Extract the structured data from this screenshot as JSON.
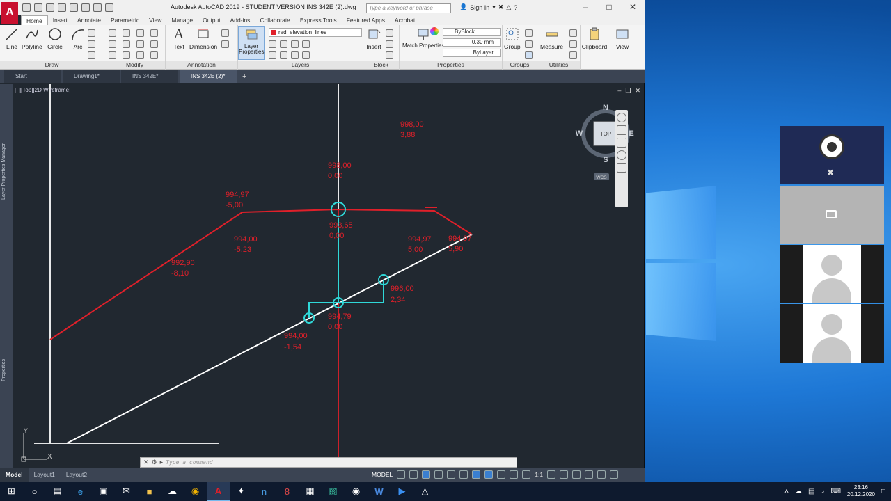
{
  "window": {
    "title": "Autodesk AutoCAD 2019 - STUDENT VERSION     INS 342E (2).dwg",
    "search_placeholder": "Type a keyword or phrase",
    "signin_label": "Sign In"
  },
  "ribbon": {
    "tabs": [
      "Home",
      "Insert",
      "Annotate",
      "Parametric",
      "View",
      "Manage",
      "Output",
      "Add-ins",
      "Collaborate",
      "Express Tools",
      "Featured Apps",
      "Acrobat"
    ],
    "draw": {
      "title": "Draw",
      "line": "Line",
      "polyline": "Polyline",
      "circle": "Circle",
      "arc": "Arc"
    },
    "modify": {
      "title": "Modify"
    },
    "annotation": {
      "title": "Annotation",
      "text": "Text",
      "dimension": "Dimension"
    },
    "layers": {
      "title": "Layers",
      "layer_properties": "Layer Properties",
      "current_layer": "red_elevation_lines"
    },
    "block": {
      "title": "Block",
      "insert": "Insert"
    },
    "properties": {
      "title": "Properties",
      "match": "Match Properties",
      "color": "ByBlock",
      "lineweight": "0.30 mm",
      "linetype": "ByLayer"
    },
    "groups": {
      "title": "Groups",
      "group": "Group"
    },
    "utilities": {
      "title": "Utilities",
      "measure": "Measure"
    },
    "clipboard": {
      "title": "Clipboard"
    },
    "view": {
      "title": "View"
    }
  },
  "doc_tabs": [
    {
      "label": "Start",
      "active": false
    },
    {
      "label": "Drawing1*",
      "active": false
    },
    {
      "label": "INS 342E*",
      "active": false
    },
    {
      "label": "INS 342E (2)*",
      "active": true
    }
  ],
  "side_panels": {
    "layer_manager": "Layer Properties Manager",
    "properties": "Properties"
  },
  "viewport": {
    "label": "[−][Top][2D Wireframe]",
    "viewcube": {
      "top": "TOP",
      "n": "N",
      "s": "S",
      "e": "E",
      "w": "W",
      "wcs": "WCS"
    },
    "ucs_y": "Y",
    "ucs_x": "X"
  },
  "annotations": [
    {
      "elev": "998,00",
      "offset": "3,88"
    },
    {
      "elev": "998,00",
      "offset": "0,00"
    },
    {
      "elev": "994,97",
      "offset": "-5,00"
    },
    {
      "elev": "993,65",
      "offset": "0,00"
    },
    {
      "elev": "994,00",
      "offset": "-5,23"
    },
    {
      "elev": "994,97",
      "offset": "5,00"
    },
    {
      "elev": "994,97",
      "offset": "5,90"
    },
    {
      "elev": "992,90",
      "offset": "-8,10"
    },
    {
      "elev": "996,00",
      "offset": "2,34"
    },
    {
      "elev": "994,79",
      "offset": "0,00"
    },
    {
      "elev": "994,00",
      "offset": "-1,54"
    }
  ],
  "command_line": {
    "placeholder": "Type a command"
  },
  "layout_tabs": [
    "Model",
    "Layout1",
    "Layout2"
  ],
  "status": {
    "model": "MODEL",
    "scale": "1:1"
  },
  "taskbar": {
    "time": "23:16",
    "date": "20.12.2020"
  },
  "colors": {
    "red_lines": "#e0202a",
    "cyan_lines": "#2fd8d8",
    "white_lines": "#ffffff",
    "canvas": "#212830"
  }
}
